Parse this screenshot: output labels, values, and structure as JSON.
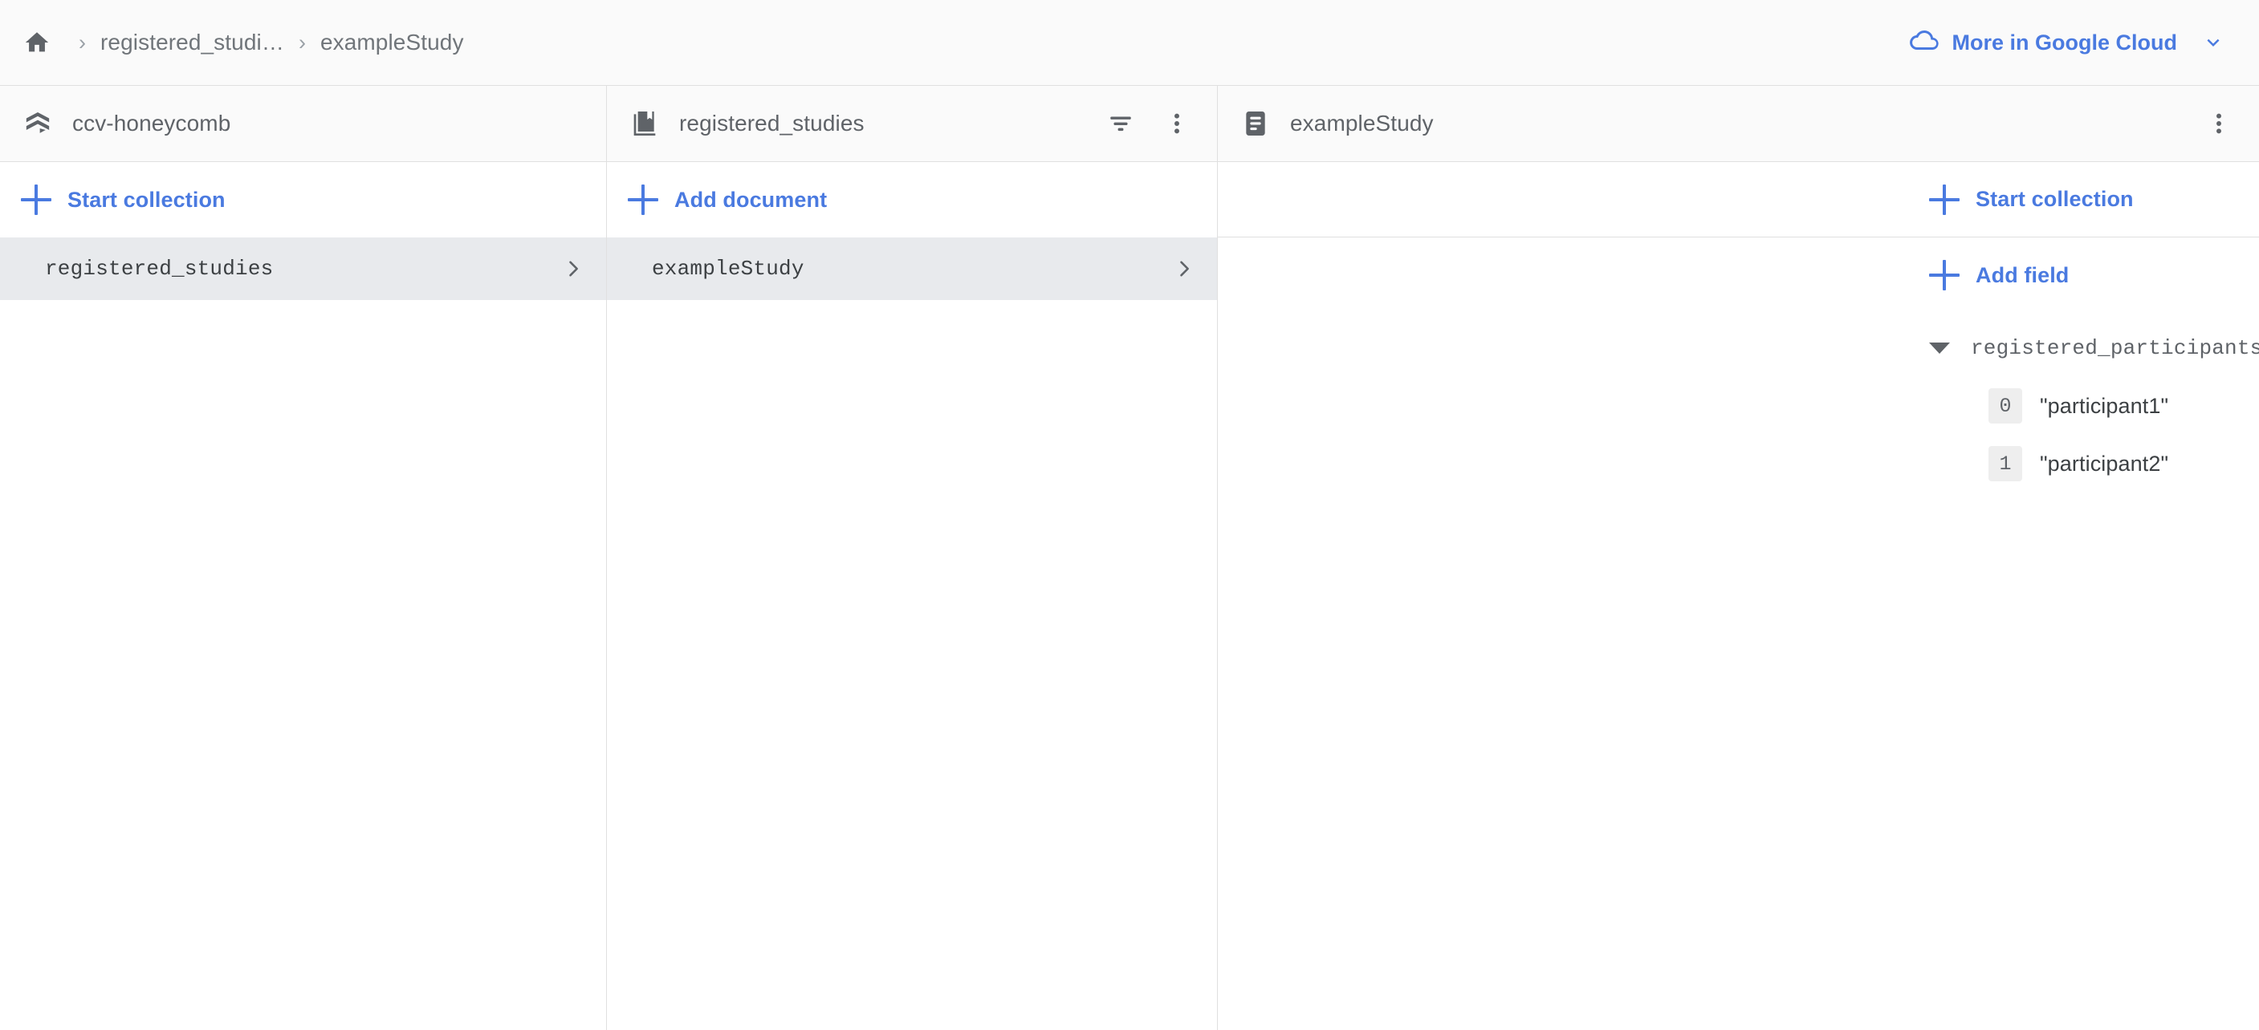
{
  "topbar": {
    "home_icon": "home-icon",
    "separator": "›",
    "breadcrumbs": [
      {
        "label": "registered_studi…"
      },
      {
        "label": "exampleStudy"
      }
    ],
    "google_cloud_link": {
      "label": "More in Google Cloud",
      "icon": "cloud-icon",
      "chevron": "chevron-down-icon"
    }
  },
  "colors": {
    "accent_blue": "#4a7ae0",
    "header_bg": "#fafafa",
    "selected_row_bg": "#e8eaed",
    "border": "#e0e0e0",
    "icon_gray": "#5f6368",
    "text_gray": "#70757a"
  },
  "panels": {
    "database": {
      "header": {
        "icon": "firestore-icon",
        "title": "ccv-honeycomb"
      },
      "actions": [
        {
          "label": "Start collection",
          "icon": "plus-icon"
        }
      ],
      "items": [
        {
          "name": "registered_studies",
          "selected": true,
          "chevron": "chevron-right-icon"
        }
      ]
    },
    "collection": {
      "header": {
        "icon": "collection-icon",
        "title": "registered_studies",
        "filter_icon": "filter-icon",
        "overflow_icon": "more-vert-icon"
      },
      "actions": [
        {
          "label": "Add document",
          "icon": "plus-icon"
        }
      ],
      "items": [
        {
          "name": "exampleStudy",
          "selected": true,
          "chevron": "chevron-right-icon"
        }
      ]
    },
    "document": {
      "header": {
        "icon": "document-icon",
        "title": "exampleStudy",
        "overflow_icon": "more-vert-icon"
      },
      "actions": [
        {
          "label": "Start collection",
          "icon": "plus-icon"
        },
        {
          "label": "Add field",
          "icon": "plus-icon"
        }
      ],
      "fields": [
        {
          "name": "registered_participants",
          "expanded": true,
          "items": [
            {
              "index": "0",
              "value": "\"participant1\""
            },
            {
              "index": "1",
              "value": "\"participant2\""
            }
          ]
        }
      ]
    }
  }
}
